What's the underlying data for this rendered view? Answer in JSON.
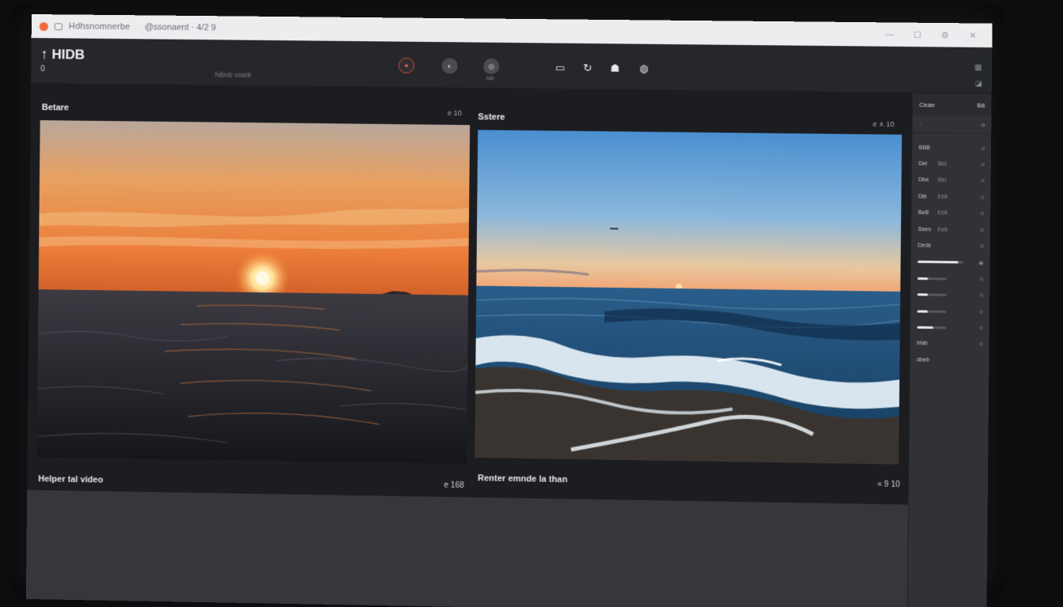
{
  "window": {
    "title": "Hdhsnomnerbe",
    "title_extra": "@ssonaent · 4/2 9",
    "controls": [
      "—",
      "☐",
      "⚙",
      "✕"
    ]
  },
  "toolbar": {
    "brand": "HIDB",
    "brand_icon": "arrow-up-icon",
    "sub_left": "0",
    "sub_center": "hibnb osiek",
    "record_label": "rec",
    "tool2": "◐",
    "tool3": "◎",
    "tool3_label": "tab",
    "icons": [
      "▭",
      "↻",
      "☗",
      "◍"
    ],
    "right_top": "▦",
    "right_bottom": "◪"
  },
  "left_panel": {
    "label": "Betare",
    "meta": "e 10",
    "caption": "Helper tal video",
    "caption_meta": "e 168"
  },
  "right_panel": {
    "label": "Sstere",
    "meta": "e ∧ 10",
    "caption": "Renter emnde la than",
    "caption_meta": "« 9 10"
  },
  "sidebar": {
    "head_left": "Ceae",
    "head_right": "B8",
    "row2_left": "·",
    "row2_right": "o",
    "rows": [
      {
        "k": "BBB",
        "v": "",
        "e": "o"
      },
      {
        "k": "Del",
        "v": "Bbl",
        "e": "o"
      },
      {
        "k": "Dbe",
        "v": "Bel",
        "e": "o"
      },
      {
        "k": "Dib",
        "v": "Ebb",
        "e": "o"
      },
      {
        "k": "BeB",
        "v": "Ebb",
        "e": "o"
      },
      {
        "k": "Seen",
        "v": "Eeb",
        "e": "o"
      },
      {
        "k": "Deds",
        "v": "",
        "e": "o"
      }
    ],
    "sliders": [
      0.9,
      0.35,
      0.35,
      0.35,
      0.55
    ],
    "tail_rows": [
      "blab",
      "dbeb"
    ]
  },
  "colors": {
    "accent_record": "#d64532",
    "bg_dark": "#1c1d21",
    "sidebar_bg": "#303236"
  }
}
